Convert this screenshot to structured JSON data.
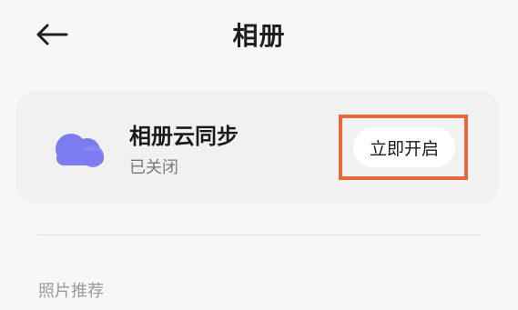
{
  "header": {
    "title": "相册",
    "back_icon": "arrow-left-icon"
  },
  "cloud_sync": {
    "icon": "cloud-icon",
    "icon_color": "#7b7cf0",
    "title": "相册云同步",
    "status": "已关闭",
    "enable_label": "立即开启",
    "highlight_color": "#e9683b"
  },
  "sections": {
    "photo_recommend_label": "照片推荐"
  }
}
